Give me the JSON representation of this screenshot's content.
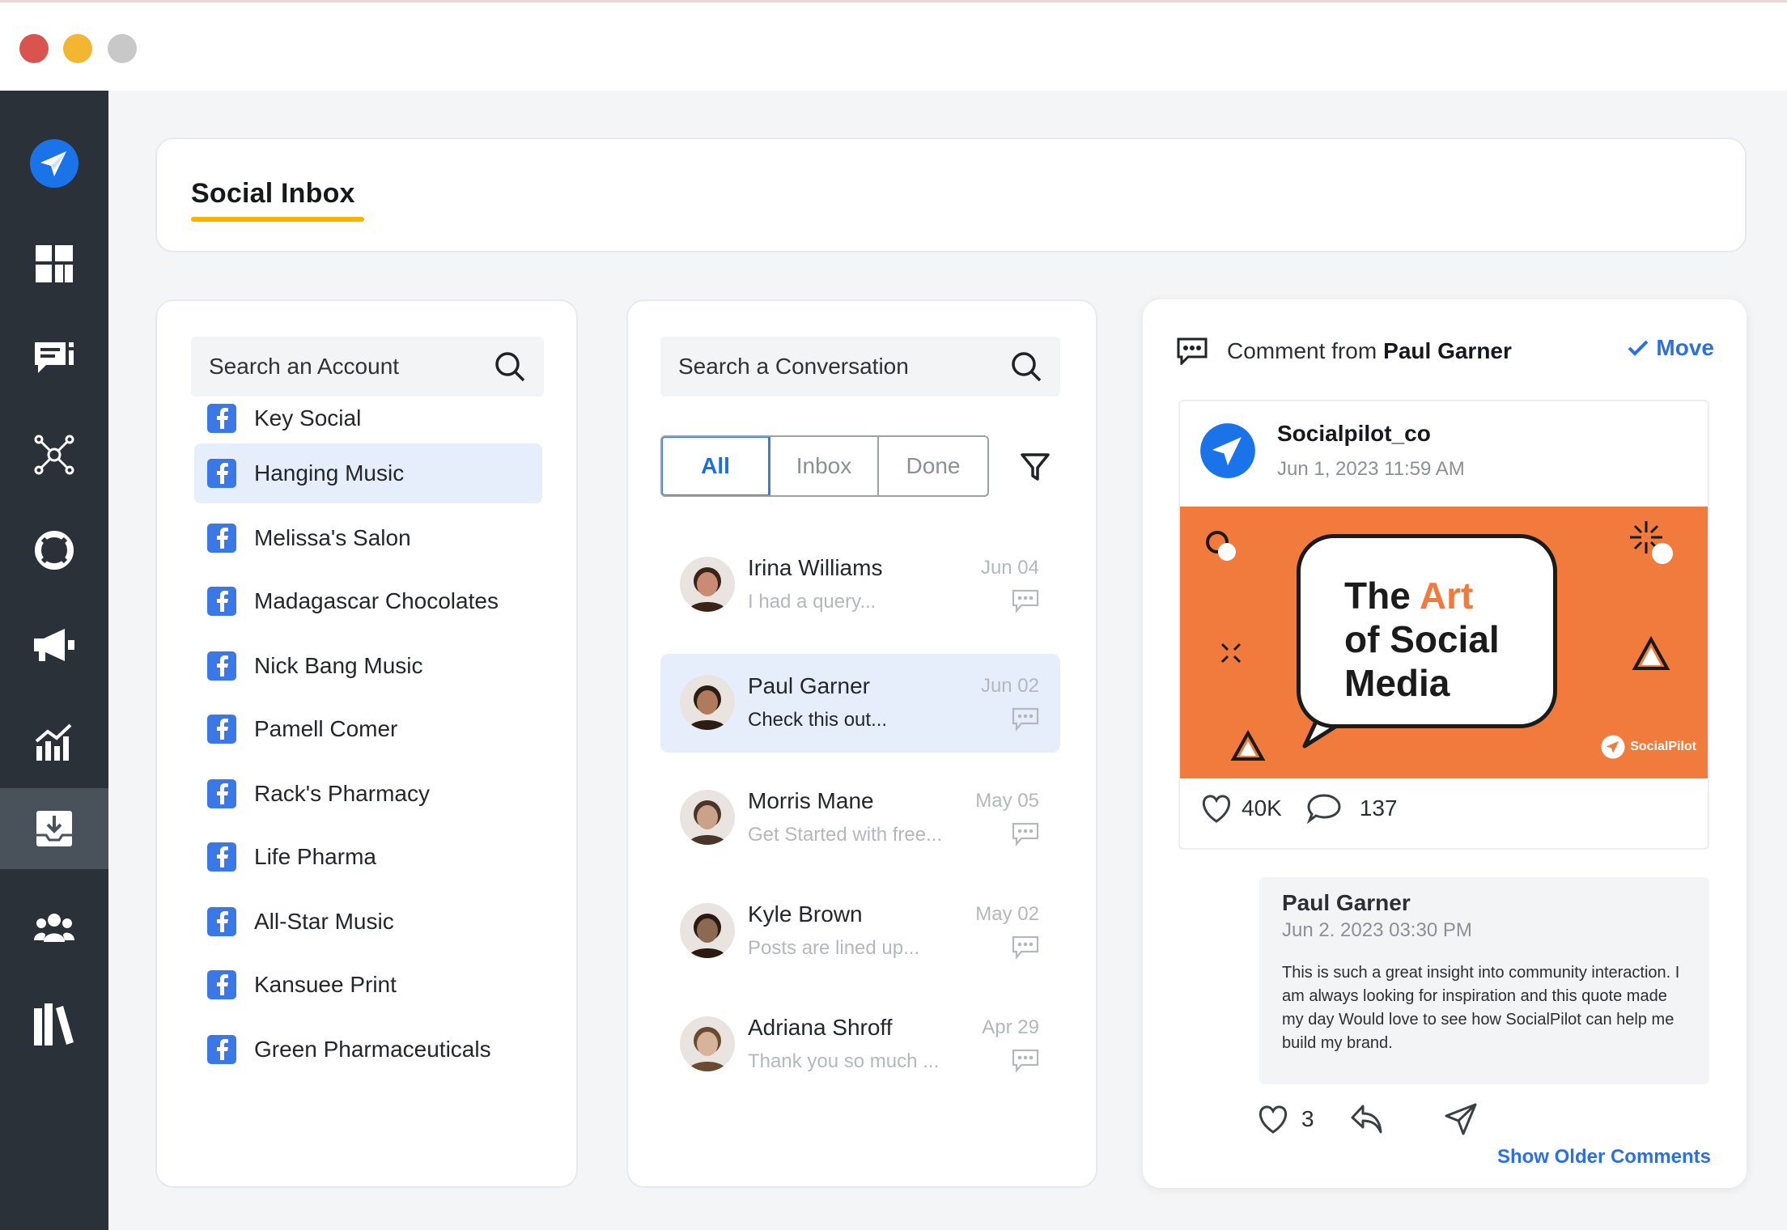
{
  "window": {
    "controls": [
      "close",
      "minimize",
      "zoom"
    ]
  },
  "colors": {
    "accent": "#2d6fdd",
    "underline": "#f4b400",
    "sidebar": "#2b3138",
    "post_bg": "#f07b3c"
  },
  "sidebar": {
    "items": [
      {
        "icon": "paper-plane-logo-icon"
      },
      {
        "icon": "dashboard-icon"
      },
      {
        "icon": "posts-icon"
      },
      {
        "icon": "connections-icon"
      },
      {
        "icon": "lifebuoy-icon"
      },
      {
        "icon": "megaphone-icon"
      },
      {
        "icon": "analytics-icon"
      },
      {
        "icon": "inbox-icon",
        "active": true
      },
      {
        "icon": "team-icon"
      },
      {
        "icon": "library-icon"
      }
    ]
  },
  "header": {
    "title": "Social Inbox"
  },
  "accounts": {
    "search_placeholder": "Search an Account",
    "items": [
      {
        "label": "Key Social"
      },
      {
        "label": "Hanging Music",
        "selected": true
      },
      {
        "label": "Melissa's Salon"
      },
      {
        "label": "Madagascar Chocolates"
      },
      {
        "label": "Nick Bang Music"
      },
      {
        "label": "Pamell Comer"
      },
      {
        "label": "Rack's Pharmacy"
      },
      {
        "label": "Life Pharma"
      },
      {
        "label": "All-Star Music"
      },
      {
        "label": "Kansuee Print"
      },
      {
        "label": "Green Pharmaceuticals"
      }
    ]
  },
  "conversations": {
    "search_placeholder": "Search a Conversation",
    "tabs": [
      {
        "label": "All",
        "active": true
      },
      {
        "label": "Inbox"
      },
      {
        "label": "Done"
      }
    ],
    "items": [
      {
        "name": "Irina Williams",
        "preview": "I had a query...",
        "date": "Jun 04"
      },
      {
        "name": "Paul Garner",
        "preview": "Check this out...",
        "date": "Jun 02",
        "selected": true
      },
      {
        "name": "Morris Mane",
        "preview": "Get Started with free...",
        "date": "May 05"
      },
      {
        "name": "Kyle Brown",
        "preview": "Posts are lined up...",
        "date": "May 02"
      },
      {
        "name": "Adriana Shroff",
        "preview": "Thank you so much ...",
        "date": "Apr 29"
      }
    ]
  },
  "detail": {
    "heading_prefix": "Comment from",
    "heading_name": "Paul Garner",
    "move_label": "Move",
    "post": {
      "author": "Socialpilot_co",
      "date": "Jun 1, 2023 11:59 AM",
      "image_text": {
        "line1_a": "The ",
        "line1_b": "Art",
        "line2": "of Social",
        "line3": "Media"
      },
      "image_brand": "SocialPilot",
      "likes": "40K",
      "comments": "137"
    },
    "reply": {
      "name": "Paul Garner",
      "date": "Jun 2. 2023 03:30 PM",
      "text": "This is such a great insight into community interaction. I am always looking for inspiration and this quote made my day Would love to see how SocialPilot can help me build my brand.",
      "likes": "3"
    },
    "show_older": "Show Older Comments"
  }
}
